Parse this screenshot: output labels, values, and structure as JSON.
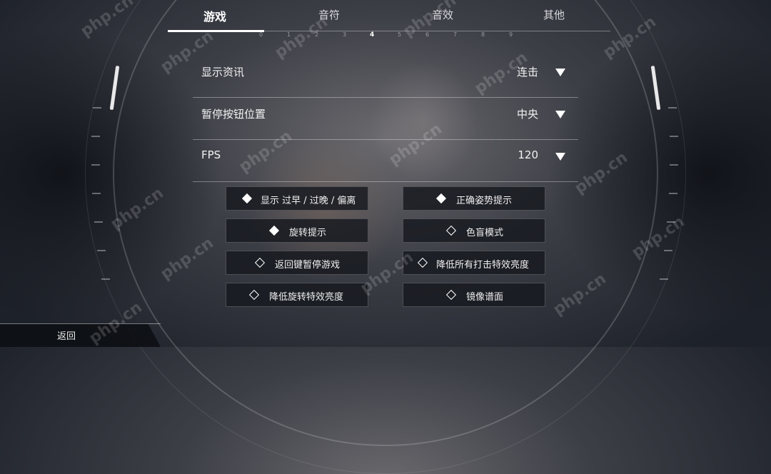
{
  "tabs": [
    {
      "label": "游戏",
      "active": true
    },
    {
      "label": "音符",
      "active": false
    },
    {
      "label": "音效",
      "active": false
    },
    {
      "label": "其他",
      "active": false
    }
  ],
  "scale": {
    "labels": [
      "0",
      "1",
      "2",
      "3",
      "4",
      "5",
      "6",
      "7",
      "8",
      "9"
    ],
    "active_label": "4"
  },
  "settings": [
    {
      "label": "显示资讯",
      "value": "连击"
    },
    {
      "label": "暂停按钮位置",
      "value": "中央"
    },
    {
      "label": "FPS",
      "value": "120"
    }
  ],
  "options": [
    {
      "label": "显示 过早 / 过晚 / 偏离",
      "checked": true
    },
    {
      "label": "正确姿势提示",
      "checked": true
    },
    {
      "label": "旋转提示",
      "checked": true
    },
    {
      "label": "色盲模式",
      "checked": false
    },
    {
      "label": "返回键暂停游戏",
      "checked": false
    },
    {
      "label": "降低所有打击特效亮度",
      "checked": false
    },
    {
      "label": "降低旋转特效亮度",
      "checked": false
    },
    {
      "label": "镜像谱面",
      "checked": false
    }
  ],
  "back": {
    "label": "返回"
  },
  "watermark": "php.cn",
  "colors": {
    "accent": "#ffffff",
    "panel": "#16181e"
  }
}
